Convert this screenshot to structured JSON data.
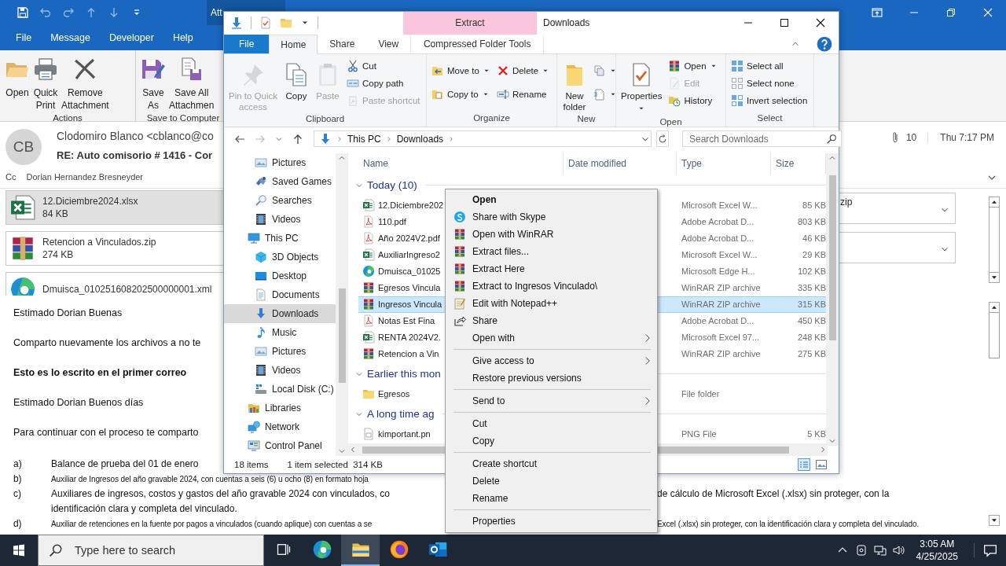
{
  "outlook": {
    "contextual_tab": "Att",
    "menu_tabs": [
      "File",
      "Message",
      "Developer",
      "Help"
    ],
    "ribbon_groups": [
      {
        "label": "Actions",
        "buttons": [
          "Open",
          "Quick\nPrint",
          "Remove\nAttachment"
        ]
      },
      {
        "label": "Save to Computer",
        "buttons": [
          "Save\nAs",
          "Save All\nAttachmen"
        ]
      }
    ],
    "message": {
      "avatar": "CB",
      "sender": "Clodomiro Blanco <cblanco@co",
      "subject": "RE: Auto comisorio # 1416 - Cor",
      "cc_label": "Cc",
      "cc": "Dorian Hernandez Bresneyder",
      "attachment_count": "10",
      "time": "Thu 7:17 PM"
    },
    "attachments": [
      {
        "name": "12.Diciembre2024.xlsx",
        "size": "84 KB",
        "kind": "excel",
        "selected": true
      },
      {
        "name": "Retencion a Vinculados.zip",
        "size": "274 KB",
        "kind": "rar",
        "selected": false
      },
      {
        "name": "Dmuisca_010251608202500000001.xml",
        "kind": "edge",
        "selected": false
      }
    ],
    "attachments_right": [
      {
        "kind": "attachment",
        "name": "zip"
      },
      {
        "kind": "attachment"
      }
    ],
    "body": {
      "paragraphs": [
        {
          "text": "Estimado Dorian Buenas",
          "bold": false
        },
        {
          "text": "Comparto nuevamente los archivos a no te",
          "bold": false
        },
        {
          "text": "Esto es lo escrito en el primer correo",
          "bold": true
        },
        {
          "text": "Estimado Dorian Buenos días",
          "bold": false
        },
        {
          "text": "Para continuar con el proceso te comparto",
          "bold": false
        }
      ],
      "list": [
        {
          "marker": "a)",
          "kind": "normal",
          "lines": [
            [
              "Balance de prueba del 01 de enero"
            ]
          ]
        },
        {
          "marker": "b)",
          "kind": "small",
          "lines": [
            [
              "Auxiliar de Ingresos del año gravable 2024, con cuentas a seis (6) u ocho (8) en formato hoja"
            ]
          ]
        },
        {
          "marker": "c)",
          "kind": "normal",
          "lines": [
            [
              "Auxiliares de ingresos, costos y gastos del año gravable 2024 con vinculados, co",
              "de cálculo de Microsoft Excel (.xlsx) sin proteger, con la"
            ],
            [
              "identificación clara y completa del vinculado."
            ]
          ]
        },
        {
          "marker": "d)",
          "kind": "small",
          "lines": [
            [
              "Auxiliar de retenciones en la fuente por pagos a vinculados (cuando aplique) con cuentas a se",
              "Excel (.xlsx) sin proteger, con la identificación clara y completa del vinculado."
            ]
          ]
        }
      ]
    }
  },
  "explorer": {
    "context_tab": "Extract",
    "title": "Downloads",
    "tabs": [
      {
        "label": "File",
        "kind": "file",
        "selected": false
      },
      {
        "label": "Home",
        "kind": "tab",
        "selected": true
      },
      {
        "label": "Share",
        "kind": "tab",
        "selected": false
      },
      {
        "label": "View",
        "kind": "tab",
        "selected": false
      },
      {
        "label": "Compressed Folder Tools",
        "kind": "tab",
        "selected": false
      }
    ],
    "ribbon_groups": [
      {
        "label": "Clipboard",
        "columns": [
          [
            {
              "label": "Pin to Quick\naccess",
              "kind": "large",
              "disabled": true
            }
          ],
          [
            {
              "label": "Copy",
              "kind": "large",
              "disabled": false
            }
          ],
          [
            {
              "label": "Paste",
              "kind": "large",
              "disabled": true
            }
          ],
          [
            {
              "label": "Cut",
              "kind": "small",
              "disabled": false
            },
            {
              "label": "Copy path",
              "kind": "small",
              "disabled": false
            },
            {
              "label": "Paste shortcut",
              "kind": "small",
              "disabled": true
            }
          ]
        ]
      },
      {
        "label": "Organize",
        "columns": [
          [
            {
              "label": "Move to",
              "kind": "small",
              "disabled": false,
              "dropdown": true
            },
            {
              "label": "Copy to",
              "kind": "small",
              "disabled": false,
              "dropdown": true
            }
          ],
          [
            {
              "label": "Delete",
              "kind": "small",
              "disabled": false,
              "dropdown": true
            },
            {
              "label": "Rename",
              "kind": "small",
              "disabled": false
            }
          ]
        ]
      },
      {
        "label": "New",
        "columns": [
          [
            {
              "label": "New\nfolder",
              "kind": "large",
              "disabled": false
            }
          ],
          [
            {
              "kind": "small",
              "disabled": false,
              "dropdown": true
            },
            {
              "kind": "small",
              "disabled": false,
              "dropdown": true
            }
          ]
        ]
      },
      {
        "label": "Open",
        "columns": [
          [
            {
              "label": "Properties",
              "kind": "large",
              "disabled": false,
              "dropdown": true
            }
          ],
          [
            {
              "label": "Open",
              "kind": "small",
              "disabled": false,
              "dropdown": true
            },
            {
              "label": "Edit",
              "kind": "small",
              "disabled": true
            },
            {
              "label": "History",
              "kind": "small",
              "disabled": false
            }
          ]
        ]
      },
      {
        "label": "Select",
        "columns": [
          [
            {
              "label": "Select all",
              "kind": "small",
              "disabled": false
            },
            {
              "label": "Select none",
              "kind": "small",
              "disabled": false
            },
            {
              "label": "Invert selection",
              "kind": "small",
              "disabled": false
            }
          ]
        ]
      }
    ],
    "path": [
      "This PC",
      "Downloads"
    ],
    "search": {
      "placeholder": "Search Downloads"
    },
    "nav": [
      {
        "children": [
          {
            "label": "Pictures",
            "selected": false
          },
          {
            "label": "Saved Games",
            "selected": false
          },
          {
            "label": "Searches",
            "selected": false
          },
          {
            "label": "Videos",
            "selected": false
          }
        ]
      },
      {
        "label": "This PC",
        "selected": false,
        "children": [
          {
            "label": "3D Objects",
            "selected": false
          },
          {
            "label": "Desktop",
            "selected": false
          },
          {
            "label": "Documents",
            "selected": false
          },
          {
            "label": "Downloads",
            "selected": true
          },
          {
            "label": "Music",
            "selected": false
          },
          {
            "label": "Pictures",
            "selected": false
          },
          {
            "label": "Videos",
            "selected": false
          },
          {
            "label": "Local Disk (C:)",
            "selected": false
          }
        ]
      },
      {
        "label": "Libraries",
        "selected": false
      },
      {
        "label": "Network",
        "selected": false
      },
      {
        "label": "Control Panel",
        "selected": false
      }
    ],
    "columns": [
      "Name",
      "Date modified",
      "Type",
      "Size"
    ],
    "groups": [
      {
        "label": "Today (10)",
        "expanded": true,
        "files": [
          {
            "name": "12.Diciembre202",
            "type": "Microsoft Excel W...",
            "size": "85 KB",
            "kind": "excel",
            "selected": false
          },
          {
            "name": "110.pdf",
            "type": "Adobe Acrobat D...",
            "size": "803 KB",
            "kind": "pdf",
            "selected": false
          },
          {
            "name": "Año 2024V2.pdf",
            "type": "Adobe Acrobat D...",
            "size": "46 KB",
            "kind": "pdf",
            "selected": false
          },
          {
            "name": "AuxiliarIngreso2",
            "type": "Microsoft Excel W...",
            "size": "29 KB",
            "kind": "excel",
            "selected": false
          },
          {
            "name": "Dmuisca_01025",
            "type": "Microsoft Edge H...",
            "size": "102 KB",
            "kind": "edge",
            "selected": false
          },
          {
            "name": "Egresos Vincula",
            "type": "WinRAR ZIP archive",
            "size": "335 KB",
            "kind": "rar",
            "selected": false
          },
          {
            "name": "Ingresos Vincula",
            "type": "WinRAR ZIP archive",
            "size": "315 KB",
            "kind": "rar",
            "selected": true
          },
          {
            "name": "Notas Est Fina",
            "type": "Adobe Acrobat D...",
            "size": "450 KB",
            "kind": "pdf",
            "selected": false
          },
          {
            "name": "RENTA 2024V2.",
            "type": "Microsoft Excel 97...",
            "size": "248 KB",
            "kind": "excel",
            "selected": false
          },
          {
            "name": "Retencion a Vin",
            "type": "WinRAR ZIP archive",
            "size": "275 KB",
            "kind": "rar",
            "selected": false
          }
        ]
      },
      {
        "label": "Earlier this mon",
        "expanded": true,
        "files": [
          {
            "name": "Egresos",
            "type": "File folder",
            "kind": "folder",
            "selected": false
          }
        ]
      },
      {
        "label": "A long time ag",
        "expanded": true,
        "files": [
          {
            "name": "kimportant.pn",
            "type": "PNG File",
            "size": "5 KB",
            "kind": "image",
            "selected": false
          }
        ]
      }
    ],
    "status": {
      "count": "18 items",
      "selection": "1 item selected  314 KB"
    }
  },
  "context_menu": [
    [
      {
        "label": "Open",
        "default": true,
        "submenu": false
      },
      {
        "label": "Share with Skype",
        "default": false,
        "submenu": false
      },
      {
        "label": "Open with WinRAR",
        "default": false,
        "submenu": false
      },
      {
        "label": "Extract files...",
        "default": false,
        "submenu": false
      },
      {
        "label": "Extract Here",
        "default": false,
        "submenu": false
      },
      {
        "label": "Extract to Ingresos Vinculado\\",
        "default": false,
        "submenu": false
      },
      {
        "label": "Edit with Notepad++",
        "default": false,
        "submenu": false
      },
      {
        "label": "Share",
        "default": false,
        "submenu": false
      },
      {
        "label": "Open with",
        "default": false,
        "submenu": true
      }
    ],
    [
      {
        "label": "Give access to",
        "default": false,
        "submenu": true
      },
      {
        "label": "Restore previous versions",
        "default": false,
        "submenu": false
      }
    ],
    [
      {
        "label": "Send to",
        "default": false,
        "submenu": true
      }
    ],
    [
      {
        "label": "Cut",
        "default": false,
        "submenu": false
      },
      {
        "label": "Copy",
        "default": false,
        "submenu": false
      }
    ],
    [
      {
        "label": "Create shortcut",
        "default": false,
        "submenu": false
      },
      {
        "label": "Delete",
        "default": false,
        "submenu": false
      },
      {
        "label": "Rename",
        "default": false,
        "submenu": false
      }
    ],
    [
      {
        "label": "Properties",
        "default": false,
        "submenu": false
      }
    ]
  ],
  "taskbar": {
    "search": {
      "placeholder": "Type here to search"
    },
    "apps": [
      {
        "kind": "taskview",
        "active": false
      },
      {
        "kind": "edge",
        "active": false
      },
      {
        "kind": "explorer",
        "active": true
      },
      {
        "kind": "firefox",
        "active": false
      },
      {
        "kind": "outlook",
        "active": false
      }
    ],
    "time": "3:05 AM",
    "date": "4/25/2025"
  }
}
